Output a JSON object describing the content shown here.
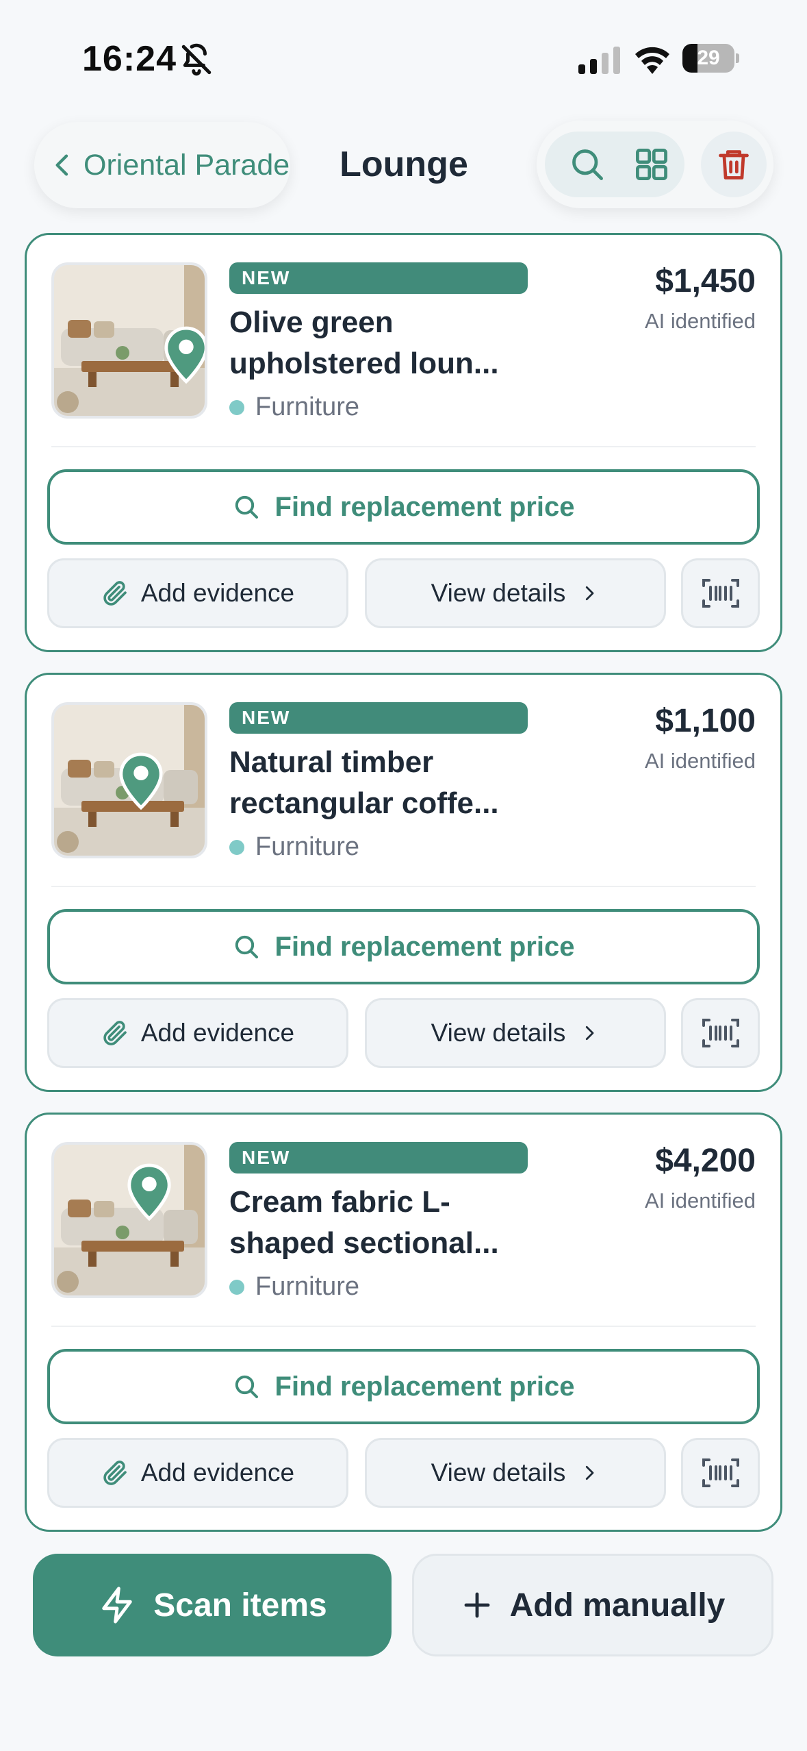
{
  "status_bar": {
    "time": "16:24",
    "battery": "29",
    "battery_level": 0.29
  },
  "header": {
    "back_label": "Oriental Parade",
    "title": "Lounge"
  },
  "items": [
    {
      "badge": "NEW",
      "title_line1": "Olive green",
      "title_line2": "upholstered loun...",
      "category": "Furniture",
      "price": "$1,450",
      "source": "AI identified",
      "find_label": "Find replacement price",
      "evidence_label": "Add evidence",
      "details_label": "View details"
    },
    {
      "badge": "NEW",
      "title_line1": "Natural timber",
      "title_line2": "rectangular coffe...",
      "category": "Furniture",
      "price": "$1,100",
      "source": "AI identified",
      "find_label": "Find replacement price",
      "evidence_label": "Add evidence",
      "details_label": "View details"
    },
    {
      "badge": "NEW",
      "title_line1": "Cream fabric L-",
      "title_line2": "shaped sectional...",
      "category": "Furniture",
      "price": "$4,200",
      "source": "AI identified",
      "find_label": "Find replacement price",
      "evidence_label": "Add evidence",
      "details_label": "View details"
    }
  ],
  "bottom_bar": {
    "scan_label": "Scan items",
    "manual_label": "Add manually"
  },
  "colors": {
    "accent": "#3f8d7a",
    "badge": "#418b7a",
    "danger": "#c0392b",
    "category_dot": "#7fcac7"
  },
  "icons": [
    "bell-slash-icon",
    "signal-icon",
    "wifi-icon",
    "battery-icon",
    "chevron-left-icon",
    "search-icon",
    "grid-icon",
    "trash-icon",
    "map-pin-icon",
    "paperclip-icon",
    "chevron-right-icon",
    "barcode-icon",
    "lightning-icon",
    "plus-icon"
  ]
}
